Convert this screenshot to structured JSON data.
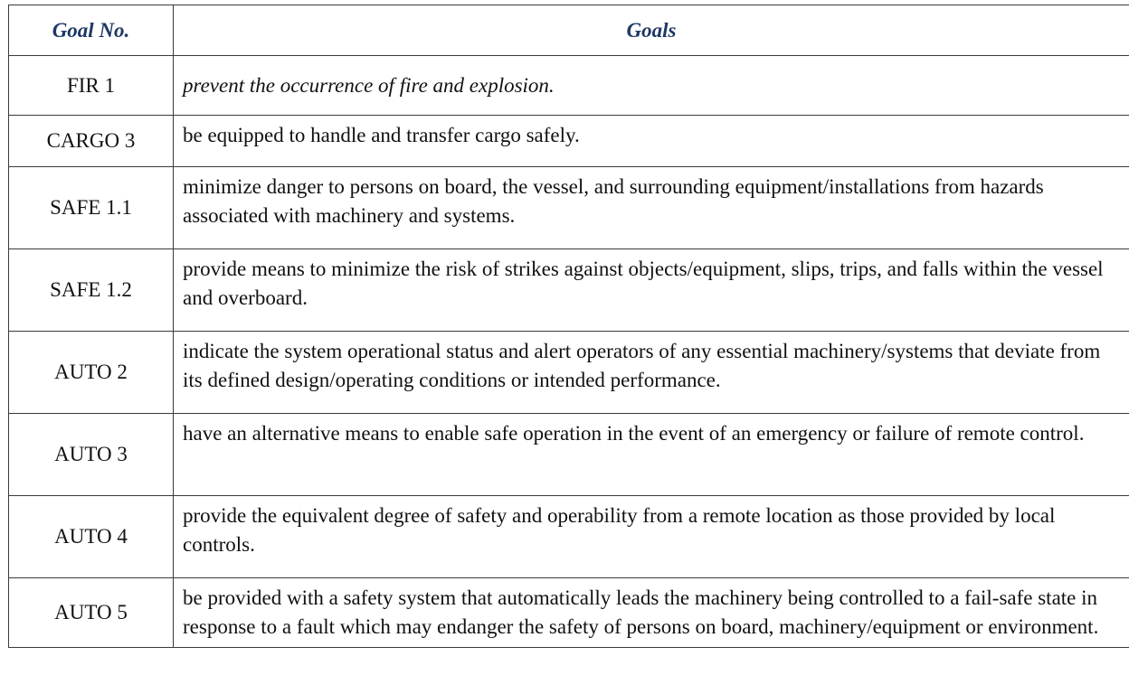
{
  "table": {
    "headers": {
      "goal_no": "Goal No.",
      "goals": "Goals"
    },
    "rows": [
      {
        "no": "FIR 1",
        "goal": "prevent the occurrence of fire and explosion."
      },
      {
        "no": "CARGO 3",
        "goal": "be equipped to handle and transfer cargo safely."
      },
      {
        "no": "SAFE 1.1",
        "goal": "minimize danger to persons on board, the vessel, and surrounding equipment/installations from hazards associated with machinery and systems."
      },
      {
        "no": "SAFE 1.2",
        "goal": "provide means to minimize the risk of strikes against objects/equipment, slips, trips, and falls within the vessel and overboard."
      },
      {
        "no": "AUTO 2",
        "goal": "indicate the system operational status and alert operators of any essential machinery/systems that deviate from its defined design/operating conditions or intended performance."
      },
      {
        "no": "AUTO 3",
        "goal": "have an alternative means to enable safe operation in the event of an emergency or failure of remote control."
      },
      {
        "no": "AUTO 4",
        "goal": "provide the equivalent degree of safety and operability from a remote location as those provided by local controls."
      },
      {
        "no": "AUTO 5",
        "goal": "be provided with a safety system that automatically leads the machinery being controlled to a fail-safe state in response to a fault which may endanger the safety of persons on board, machinery/equipment or environment."
      }
    ]
  },
  "colors": {
    "header_text": "#1f3864",
    "border": "#3a3a3a",
    "body_text": "#111111"
  }
}
